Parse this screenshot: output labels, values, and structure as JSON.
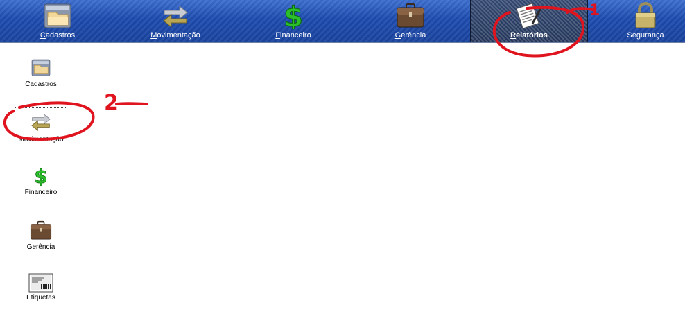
{
  "toolbar": {
    "items": [
      {
        "label": "Cadastros",
        "ul": "C",
        "rest": "adastros",
        "icon": "folder-icon"
      },
      {
        "label": "Movimentação",
        "ul": "M",
        "rest": "ovimentação",
        "icon": "swap-arrows-icon"
      },
      {
        "label": "Financeiro",
        "ul": "F",
        "rest": "inanceiro",
        "icon": "dollar-icon"
      },
      {
        "label": "Gerência",
        "ul": "G",
        "rest": "erência",
        "icon": "briefcase-icon"
      },
      {
        "label": "Relatórios",
        "ul": "R",
        "rest": "elatórios",
        "icon": "report-icon"
      },
      {
        "label": "Segurança",
        "ul": "",
        "rest": "Segurança",
        "icon": "padlock-icon"
      }
    ],
    "active": "Relatórios"
  },
  "sidebar": {
    "items": [
      {
        "label": "Cadastros",
        "icon": "folder-icon"
      },
      {
        "label": "Movimentação",
        "icon": "swap-arrows-icon"
      },
      {
        "label": "Financeiro",
        "icon": "dollar-icon"
      },
      {
        "label": "Gerência",
        "icon": "briefcase-icon"
      },
      {
        "label": "Etiquetas",
        "icon": "label-barcode-icon"
      }
    ],
    "focused": "Movimentação"
  },
  "annotations": {
    "marker_1": "1",
    "marker_2": "2"
  },
  "colors": {
    "toolbar_blue": "#1d4cb0",
    "annotation_red": "#e0141e"
  }
}
